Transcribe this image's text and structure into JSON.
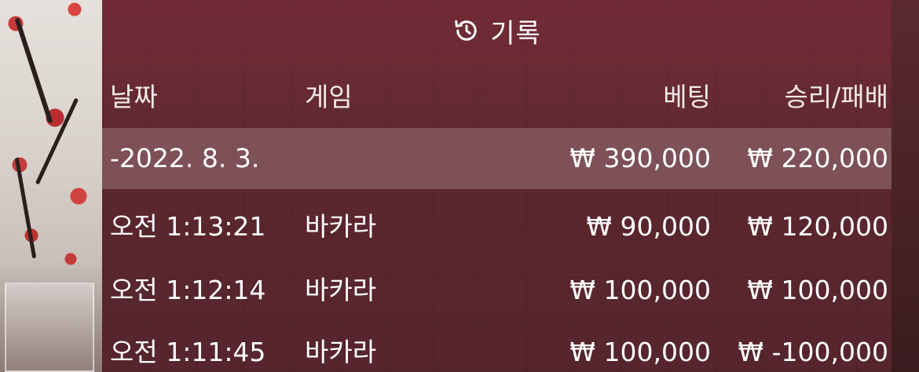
{
  "header": {
    "title": "기록",
    "icon": "history-icon"
  },
  "table": {
    "columns": {
      "date": "날짜",
      "game": "게임",
      "bet": "베팅",
      "result": "승리/패배"
    },
    "summary": {
      "date": "-2022. 8. 3.",
      "game": "",
      "bet": "₩ 390,000",
      "result": "₩ 220,000"
    },
    "rows": [
      {
        "date": "오전 1:13:21",
        "game": "바카라",
        "bet": "₩ 90,000",
        "result": "₩ 120,000"
      },
      {
        "date": "오전 1:12:14",
        "game": "바카라",
        "bet": "₩ 100,000",
        "result": "₩ 100,000"
      },
      {
        "date": "오전 1:11:45",
        "game": "바카라",
        "bet": "₩ 100,000",
        "result": "₩ -100,000"
      }
    ]
  },
  "colors": {
    "panel": "#6e2a34",
    "text": "#ffffff",
    "summary_row": "#b9a0a4"
  }
}
